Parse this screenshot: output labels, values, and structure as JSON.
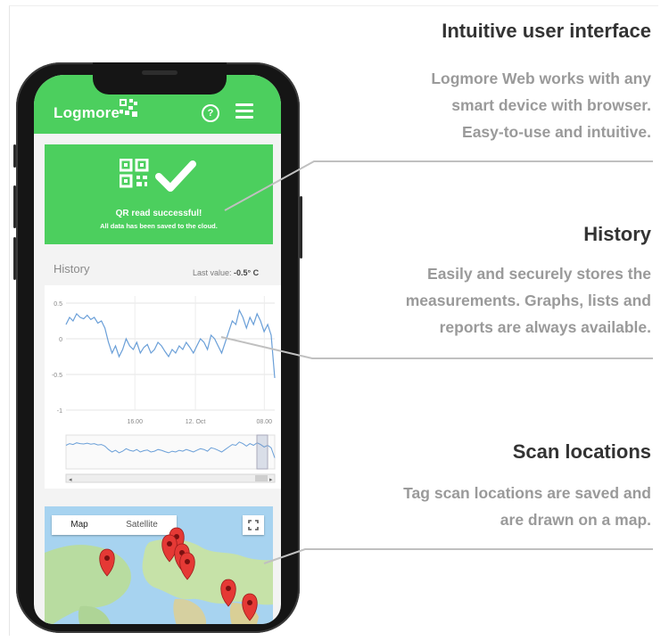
{
  "sections": [
    {
      "heading": "Intuitive user interface",
      "lines": [
        "Logmore Web works with any",
        "smart device with browser.",
        "Easy-to-use and intuitive."
      ]
    },
    {
      "heading": "History",
      "lines": [
        "Easily and securely stores the",
        "measurements. Graphs, lists and",
        "reports are always available."
      ]
    },
    {
      "heading": "Scan locations",
      "lines": [
        "Tag scan locations are saved and",
        "are drawn on a map."
      ]
    }
  ],
  "app": {
    "brand": "Logmore·",
    "help_icon": "question-circle-icon",
    "menu_icon": "hamburger-menu-icon",
    "success": {
      "title": "QR read successful!",
      "subtitle": "All data has been saved to the cloud."
    },
    "history": {
      "title": "History",
      "last_value_label": "Last value:",
      "last_value": "-0.5° C"
    },
    "map": {
      "tabs": [
        "Map",
        "Satellite"
      ],
      "fullscreen_icon": "fullscreen-icon"
    }
  },
  "colors": {
    "accent": "#4ccf5e",
    "line": "#6a9fd8",
    "text_dark": "#333333",
    "text_muted": "#9a9a9a"
  },
  "chart_data": {
    "type": "line",
    "title": "",
    "xlabel": "",
    "ylabel": "",
    "x_tick_labels": [
      "16.00",
      "12. Oct",
      "08.00"
    ],
    "y_tick_labels": [
      "0.5",
      "0",
      "-0.5",
      "-1"
    ],
    "ylim": [
      -1,
      0.6
    ],
    "grid": true,
    "series": [
      {
        "values": [
          0.2,
          0.3,
          0.25,
          0.35,
          0.3,
          0.28,
          0.33,
          0.27,
          0.3,
          0.22,
          0.25,
          0.15,
          -0.05,
          -0.2,
          -0.1,
          -0.25,
          -0.15,
          0.0,
          -0.1,
          -0.15,
          -0.05,
          -0.2,
          -0.12,
          -0.08,
          -0.2,
          -0.15,
          -0.05,
          -0.1,
          -0.18,
          -0.25,
          -0.15,
          -0.2,
          -0.1,
          -0.15,
          -0.05,
          -0.12,
          -0.2,
          -0.1,
          0.0,
          -0.05,
          -0.15,
          0.05,
          0.0,
          -0.1,
          -0.2,
          -0.05,
          0.1,
          0.25,
          0.2,
          0.4,
          0.3,
          0.15,
          0.3,
          0.2,
          0.35,
          0.25,
          0.1,
          0.2,
          0.05,
          -0.55
        ]
      }
    ]
  }
}
